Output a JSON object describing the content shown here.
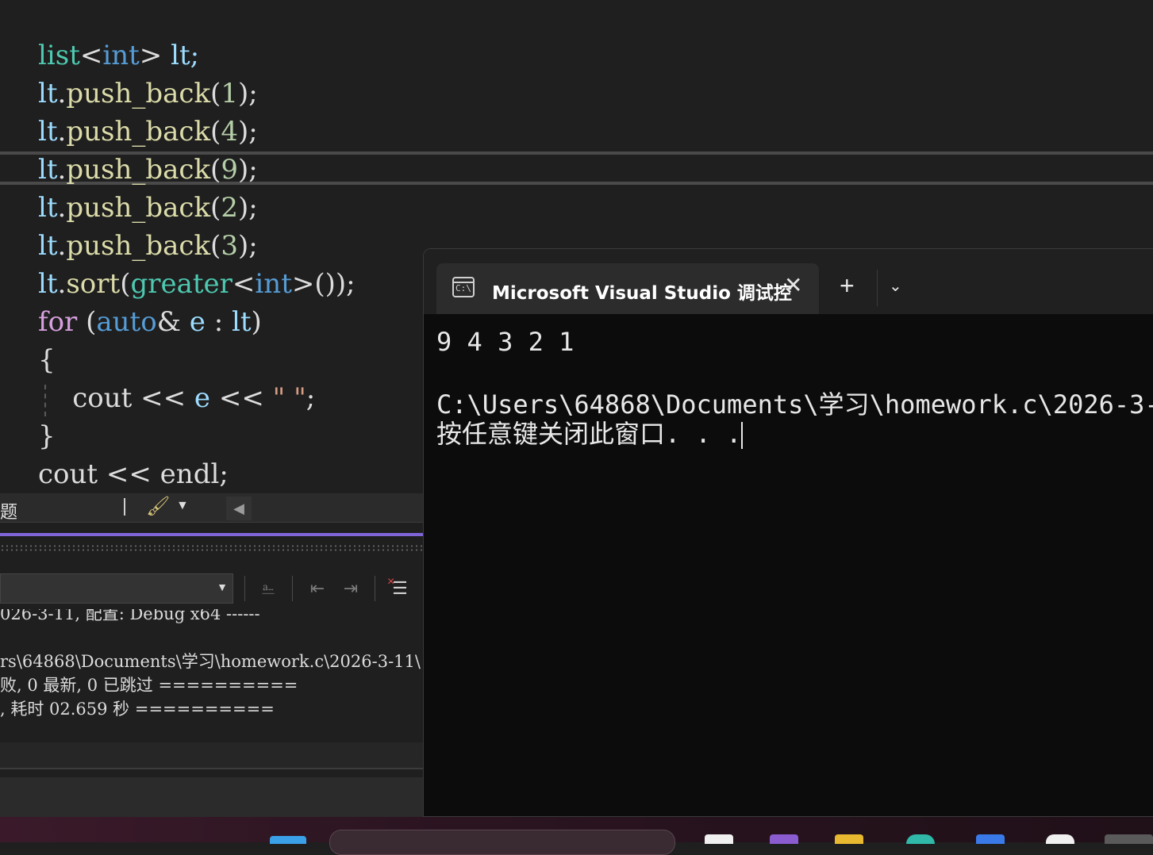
{
  "editor": {
    "lines": [
      {
        "segments": [
          {
            "t": "list",
            "c": "t-type"
          },
          {
            "t": "<",
            "c": "t-plain"
          },
          {
            "t": "int",
            "c": "t-kw"
          },
          {
            "t": ">",
            "c": "t-plain"
          },
          {
            "t": " lt;",
            "c": "t-var"
          }
        ]
      },
      {
        "segments": [
          {
            "t": "lt",
            "c": "t-var"
          },
          {
            "t": ".",
            "c": "t-plain"
          },
          {
            "t": "push_back",
            "c": "t-fn"
          },
          {
            "t": "(",
            "c": "t-plain"
          },
          {
            "t": "1",
            "c": "t-num"
          },
          {
            "t": ");",
            "c": "t-plain"
          }
        ]
      },
      {
        "segments": [
          {
            "t": "lt",
            "c": "t-var"
          },
          {
            "t": ".",
            "c": "t-plain"
          },
          {
            "t": "push_back",
            "c": "t-fn"
          },
          {
            "t": "(",
            "c": "t-plain"
          },
          {
            "t": "4",
            "c": "t-num"
          },
          {
            "t": ");",
            "c": "t-plain"
          }
        ]
      },
      {
        "segments": [
          {
            "t": "lt",
            "c": "t-var"
          },
          {
            "t": ".",
            "c": "t-plain"
          },
          {
            "t": "push_back",
            "c": "t-fn"
          },
          {
            "t": "(",
            "c": "t-plain"
          },
          {
            "t": "9",
            "c": "t-num"
          },
          {
            "t": ");",
            "c": "t-plain"
          }
        ]
      },
      {
        "segments": [
          {
            "t": "lt",
            "c": "t-var"
          },
          {
            "t": ".",
            "c": "t-plain"
          },
          {
            "t": "push_back",
            "c": "t-fn"
          },
          {
            "t": "(",
            "c": "t-plain"
          },
          {
            "t": "2",
            "c": "t-num"
          },
          {
            "t": ");",
            "c": "t-plain"
          }
        ]
      },
      {
        "segments": [
          {
            "t": "lt",
            "c": "t-var"
          },
          {
            "t": ".",
            "c": "t-plain"
          },
          {
            "t": "push_back",
            "c": "t-fn"
          },
          {
            "t": "(",
            "c": "t-plain"
          },
          {
            "t": "3",
            "c": "t-num"
          },
          {
            "t": ");",
            "c": "t-plain"
          }
        ]
      },
      {
        "segments": [
          {
            "t": "lt",
            "c": "t-var"
          },
          {
            "t": ".",
            "c": "t-plain"
          },
          {
            "t": "sort",
            "c": "t-fn"
          },
          {
            "t": "(",
            "c": "t-plain"
          },
          {
            "t": "greater",
            "c": "t-type"
          },
          {
            "t": "<",
            "c": "t-plain"
          },
          {
            "t": "int",
            "c": "t-kw"
          },
          {
            "t": ">());",
            "c": "t-plain"
          }
        ]
      },
      {
        "segments": [
          {
            "t": "for",
            "c": "t-ctrl"
          },
          {
            "t": " (",
            "c": "t-plain"
          },
          {
            "t": "auto",
            "c": "t-kw"
          },
          {
            "t": "& ",
            "c": "t-plain"
          },
          {
            "t": "e",
            "c": "t-var"
          },
          {
            "t": " : ",
            "c": "t-plain"
          },
          {
            "t": "lt",
            "c": "t-var"
          },
          {
            "t": ")",
            "c": "t-plain"
          }
        ]
      },
      {
        "segments": [
          {
            "t": "{",
            "c": "t-plain"
          }
        ]
      },
      {
        "segments": [
          {
            "t": "    cout",
            "c": "t-plain"
          },
          {
            "t": " << ",
            "c": "t-plain"
          },
          {
            "t": "e",
            "c": "t-var"
          },
          {
            "t": " << ",
            "c": "t-plain"
          },
          {
            "t": "\" \"",
            "c": "t-str"
          },
          {
            "t": ";",
            "c": "t-plain"
          }
        ]
      },
      {
        "segments": [
          {
            "t": "}",
            "c": "t-plain"
          }
        ]
      },
      {
        "segments": [
          {
            "t": "cout",
            "c": "t-plain"
          },
          {
            "t": " << ",
            "c": "t-plain"
          },
          {
            "t": "endl",
            "c": "t-plain"
          },
          {
            "t": ";",
            "c": "t-plain"
          }
        ]
      }
    ]
  },
  "panel": {
    "tab_label": "题",
    "output_lines": [
      "026-3-11, 配置: Debug x64 ------",
      "",
      "rs\\64868\\Documents\\学习\\homework.c\\2026-3-11\\",
      "败, 0 最新, 0 已跳过 ==========",
      ", 耗时 02.659 秒 =========="
    ]
  },
  "terminal": {
    "title": "Microsoft Visual Studio 调试控",
    "icon_text": "C:\\",
    "close_glyph": "✕",
    "new_tab_glyph": "+",
    "menu_glyph": "⌄",
    "lines": [
      "9 4 3 2 1",
      "",
      "C:\\Users\\64868\\Documents\\学习\\homework.c\\2026-3-",
      "按任意键关闭此窗口. . ."
    ]
  },
  "colors": {
    "accent": "#8065d9",
    "terminal_bg": "#0c0c0c",
    "editor_bg": "#1f1f1f"
  }
}
